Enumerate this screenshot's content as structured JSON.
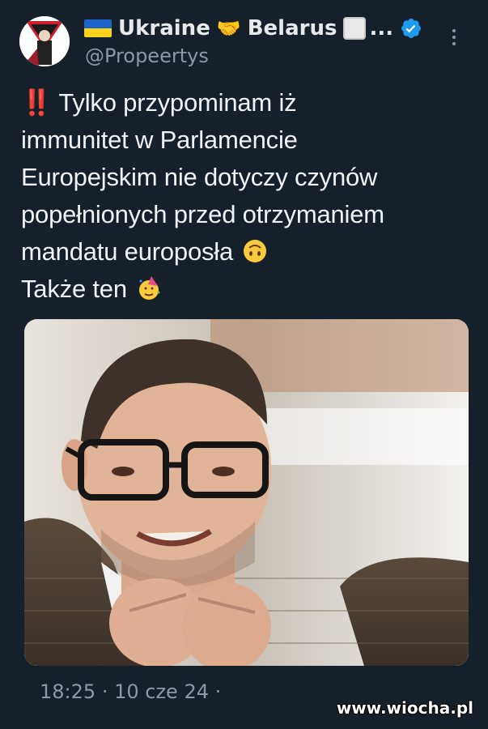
{
  "header": {
    "display_name_left": "Ukraine",
    "display_name_right": "Belarus",
    "display_name_truncation": "...",
    "handle": "@Propeertys",
    "icons": [
      "ukraine-flag-icon",
      "handshake-icon",
      "white-square-icon",
      "verified-badge-icon",
      "more-options-icon"
    ]
  },
  "tweet": {
    "emphasis_glyph": "‼️",
    "lines": [
      "Tylko przypominam iż",
      "immunitet w Parlamencie",
      "Europejskim nie dotyczy czynów",
      "popełnionych przed otrzymaniem",
      "mandatu europosła",
      "Także ten"
    ],
    "emojis": [
      "upside-down-face-emoji",
      "partying-face-emoji"
    ]
  },
  "photo": {
    "content": "portrait-photo"
  },
  "meta": {
    "time": "18:25",
    "separator": "·",
    "date": "10 cze 24",
    "trailing": "·"
  },
  "watermark": "www.wiocha.pl",
  "colors": {
    "background": "#15202b",
    "text": "#e7e9ea",
    "muted": "#8b98a5",
    "verified": "#1d9bf0",
    "emphasis": "#f4212e"
  }
}
